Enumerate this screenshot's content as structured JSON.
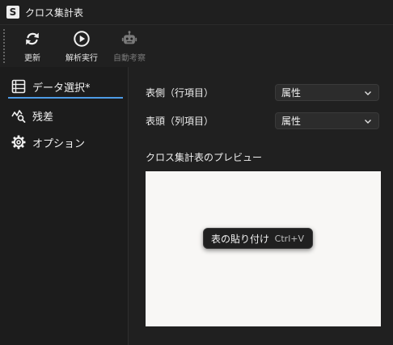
{
  "window": {
    "logo_letter": "S",
    "title": "クロス集計表"
  },
  "toolbar": {
    "refresh_label": "更新",
    "run_label": "解析実行",
    "auto_label": "自動考察"
  },
  "sidebar": {
    "items": [
      {
        "label": "データ選択*",
        "icon": "table-list-icon",
        "active": true
      },
      {
        "label": "残差",
        "icon": "chart-search-icon",
        "active": false
      },
      {
        "label": "オプション",
        "icon": "gear-icon",
        "active": false
      }
    ]
  },
  "main": {
    "row_label": "表側（行項目）",
    "row_value": "属性",
    "col_label": "表頭（列項目）",
    "col_value": "属性",
    "preview_title": "クロス集計表のプレビュー",
    "context_menu": {
      "label": "表の貼り付け",
      "shortcut": "Ctrl+V"
    }
  },
  "colors": {
    "accent": "#4d9be6",
    "background": "#202020",
    "preview_background": "#f8f7f5"
  }
}
